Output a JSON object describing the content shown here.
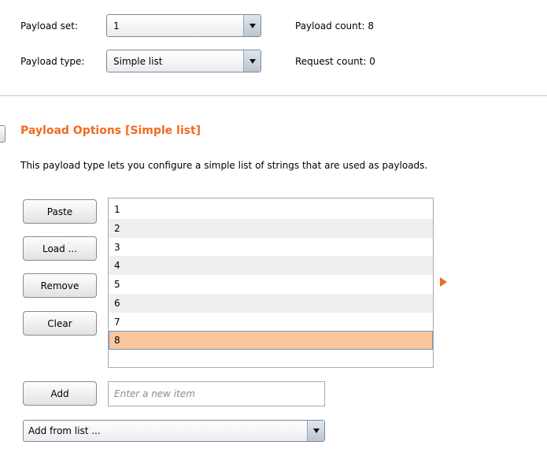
{
  "payload_set": {
    "label": "Payload set:",
    "value": "1"
  },
  "payload_type": {
    "label": "Payload type:",
    "value": "Simple list"
  },
  "payload_count": "Payload count: 8",
  "request_count": "Request count: 0",
  "section": {
    "title": "Payload Options [Simple list]",
    "description": "This payload type lets you configure a simple list of strings that are used as payloads."
  },
  "buttons": {
    "paste": "Paste",
    "load": "Load ...",
    "remove": "Remove",
    "clear": "Clear",
    "add": "Add"
  },
  "list": {
    "items": [
      "1",
      "2",
      "3",
      "4",
      "5",
      "6",
      "7",
      "8"
    ],
    "selected_index": 7
  },
  "new_item": {
    "placeholder": "Enter a new item"
  },
  "add_from_list": {
    "value": "Add from list ..."
  },
  "colors": {
    "accent": "#f26a22",
    "selection": "#fbc69c",
    "alt_row": "#efefef"
  }
}
